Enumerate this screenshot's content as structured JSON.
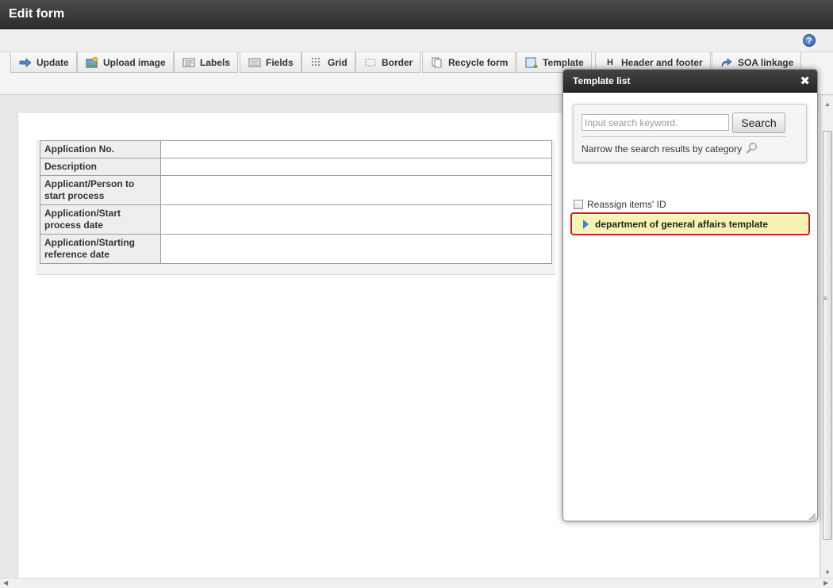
{
  "window": {
    "title": "Edit form"
  },
  "toolbar": {
    "tabs": [
      {
        "label": "Update",
        "icon": "update-icon"
      },
      {
        "label": "Upload image",
        "icon": "upload-image-icon"
      },
      {
        "label": "Labels",
        "icon": "labels-icon"
      },
      {
        "label": "Fields",
        "icon": "fields-icon"
      },
      {
        "label": "Grid",
        "icon": "grid-icon"
      },
      {
        "label": "Border",
        "icon": "border-icon"
      },
      {
        "label": "Recycle form",
        "icon": "recycle-form-icon"
      },
      {
        "label": "Template",
        "icon": "template-icon"
      },
      {
        "label": "Header and footer",
        "icon": "header-footer-icon"
      },
      {
        "label": "SOA linkage",
        "icon": "soa-linkage-icon"
      }
    ]
  },
  "form": {
    "rows": [
      {
        "label": "Application No.",
        "value": ""
      },
      {
        "label": "Description",
        "value": ""
      },
      {
        "label": "Applicant/Person to start process",
        "value": ""
      },
      {
        "label": "Application/Start process date",
        "value": ""
      },
      {
        "label": "Application/Starting reference date",
        "value": ""
      }
    ]
  },
  "template_list": {
    "title": "Template list",
    "search": {
      "placeholder": "Input search keyword.",
      "value": "",
      "button_label": "Search"
    },
    "narrow_label": "Narrow the search results by category",
    "reassign_label": "Reassign items' ID",
    "reassign_checked": false,
    "items": [
      {
        "label": "department of general affairs template",
        "selected": true
      }
    ]
  },
  "colors": {
    "highlight_border": "#d01c1c",
    "highlight_fill": "#f8f3b0",
    "title_bar": "#333333",
    "accent_blue": "#3b86d4"
  }
}
